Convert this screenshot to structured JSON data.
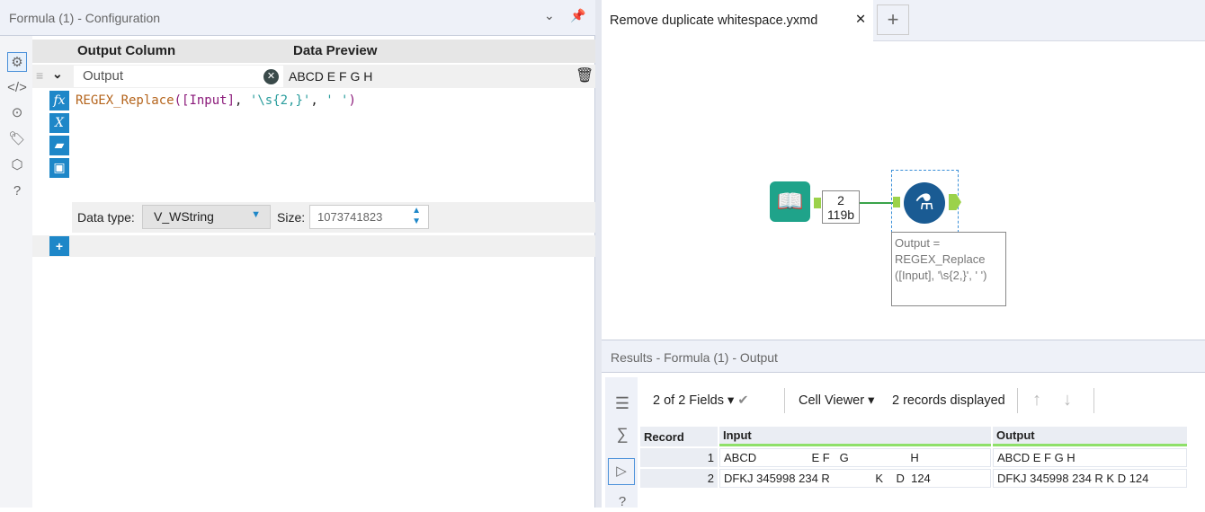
{
  "config": {
    "title": "Formula (1) - Configuration",
    "col_output": "Output Column",
    "col_preview": "Data Preview",
    "output_field": "Output",
    "preview": "ABCD E F G H",
    "expr": {
      "fn": "REGEX_Replace",
      "open": "(",
      "field": "[Input]",
      "sep1": ", ",
      "pattern": "'\\s{2,}'",
      "sep2": ", ",
      "repl": "' '",
      "close": ")"
    },
    "datatype_label": "Data type:",
    "datatype": "V_WString",
    "size_label": "Size:",
    "size": "1073741823",
    "add": "+"
  },
  "tab": {
    "name": "Remove duplicate whitespace.yxmd",
    "close": "✕",
    "new": "+"
  },
  "workflow": {
    "count": "2",
    "bytes": "119b",
    "annotation": "Output = REGEX_Replace ([Input], '\\s{2,}', ' ')"
  },
  "results": {
    "title": "Results - Formula (1) - Output",
    "fields": "2 of 2 Fields",
    "viewer": "Cell Viewer",
    "records": "2 records displayed",
    "headers": [
      "Record",
      "Input",
      "Output"
    ],
    "rows": [
      [
        "1",
        "ABCD                 E F   G                   H",
        "ABCD E F G H"
      ],
      [
        "2",
        "DFKJ 345998 234 R              K    D  124",
        "DFKJ 345998 234 R K D 124"
      ]
    ]
  }
}
